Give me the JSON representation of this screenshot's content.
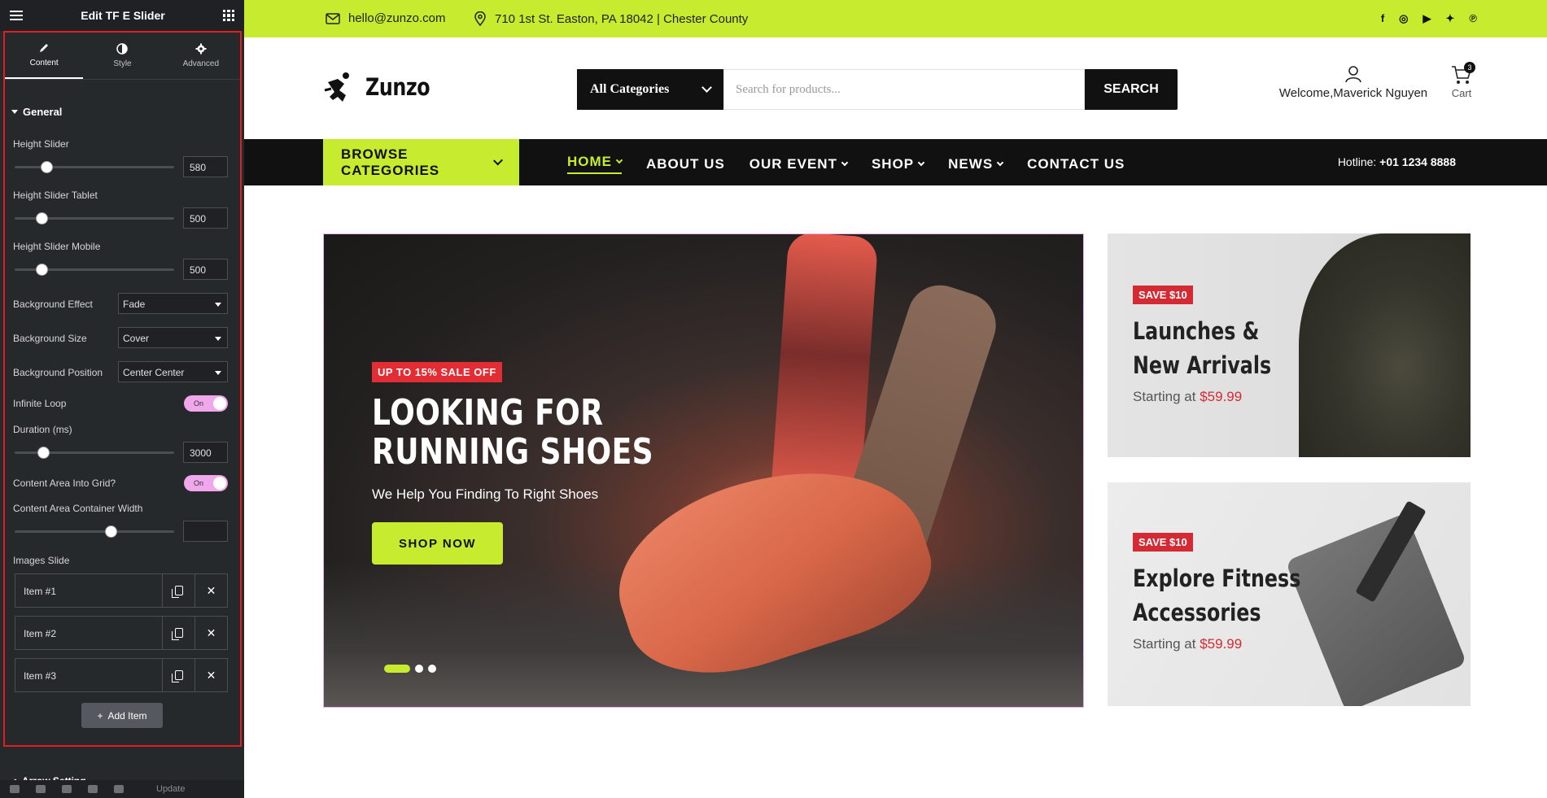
{
  "panel": {
    "title": "Edit TF E Slider",
    "tabs": [
      {
        "label": "Content",
        "icon": "pencil-icon",
        "active": true
      },
      {
        "label": "Style",
        "icon": "half-circle-icon",
        "active": false
      },
      {
        "label": "Advanced",
        "icon": "gear-icon",
        "active": false
      }
    ],
    "section": "General",
    "height_slider": {
      "label": "Height Slider",
      "value": "580",
      "level": 0.2
    },
    "height_slider_tablet": {
      "label": "Height Slider Tablet",
      "value": "500",
      "level": 0.17
    },
    "height_slider_mobile": {
      "label": "Height Slider Mobile",
      "value": "500",
      "level": 0.17
    },
    "background_effect": {
      "label": "Background Effect",
      "value": "Fade"
    },
    "background_size": {
      "label": "Background Size",
      "value": "Cover"
    },
    "background_position": {
      "label": "Background Position",
      "value": "Center Center"
    },
    "infinite_loop": {
      "label": "Infinite Loop",
      "value": "On"
    },
    "duration": {
      "label": "Duration (ms)",
      "value": "3000",
      "level": 0.18
    },
    "content_grid": {
      "label": "Content Area Into Grid?",
      "value": "On"
    },
    "container_width": {
      "label": "Content Area Container Width",
      "value": "",
      "level": 0.6
    },
    "images_slide": {
      "label": "Images Slide",
      "items": [
        "Item #1",
        "Item #2",
        "Item #3"
      ]
    },
    "add_item": "Add Item",
    "next_section": "Arrow Setting",
    "update": "Update"
  },
  "site": {
    "topbar": {
      "email": "hello@zunzo.com",
      "address": "710 1st St. Easton, PA 18042 | Chester County",
      "socials": [
        "facebook-icon",
        "instagram-icon",
        "youtube-icon",
        "twitter-icon",
        "pinterest-icon"
      ],
      "social_glyphs": [
        "f",
        "◎",
        "▶",
        "✦",
        "℗"
      ]
    },
    "logo": "Zunzo",
    "search": {
      "category": "All Categories",
      "placeholder": "Search for products...",
      "button": "SEARCH"
    },
    "account": "Welcome,Maverick Nguyen",
    "cart": {
      "label": "Cart",
      "count": "3"
    },
    "browse": "BROWSE CATEGORIES",
    "menu": [
      {
        "label": "HOME",
        "dropdown": true,
        "active": true
      },
      {
        "label": "ABOUT US",
        "dropdown": false
      },
      {
        "label": "OUR EVENT",
        "dropdown": true
      },
      {
        "label": "SHOP",
        "dropdown": true
      },
      {
        "label": "NEWS",
        "dropdown": true
      },
      {
        "label": "CONTACT US",
        "dropdown": false
      }
    ],
    "hotline_label": "Hotline: ",
    "hotline_number": "+01 1234 8888",
    "hero": {
      "tag": "UP TO 15% SALE OFF",
      "title_line1": "LOOKING FOR",
      "title_line2": "RUNNING SHOES",
      "subtitle": "We Help You Finding To Right Shoes",
      "button": "SHOP NOW",
      "slides": 3,
      "active_slide": 1
    },
    "promos": [
      {
        "tag": "SAVE $10",
        "line1": "Launches &",
        "line2": "New Arrivals",
        "starting": "Starting at ",
        "price": "$59.99"
      },
      {
        "tag": "SAVE $10",
        "line1": "Explore Fitness",
        "line2": "Accessories",
        "starting": "Starting at ",
        "price": "$59.99"
      }
    ]
  },
  "colors": {
    "accent": "#c7eb2f",
    "sale_red": "#e22d35",
    "panel_bg": "#26292c",
    "highlight_frame": "#e02020"
  }
}
